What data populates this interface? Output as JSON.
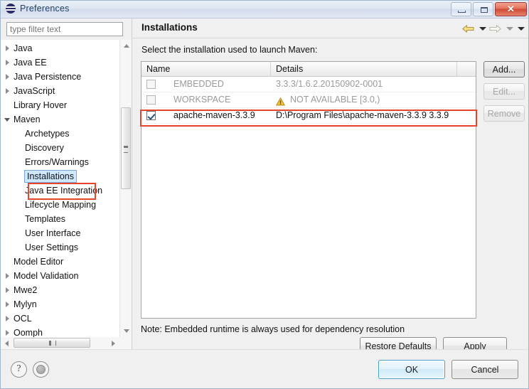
{
  "window": {
    "title": "Preferences",
    "app_icon": "eclipse-icon",
    "controls": {
      "minimize": "minimize-icon",
      "maximize": "maximize-icon",
      "close": "✕"
    }
  },
  "filter": {
    "placeholder": "type filter text",
    "value": ""
  },
  "tree": {
    "items": [
      {
        "label": "Java",
        "level": 1,
        "twisty": "collapsed",
        "selected": false
      },
      {
        "label": "Java EE",
        "level": 1,
        "twisty": "collapsed",
        "selected": false
      },
      {
        "label": "Java Persistence",
        "level": 1,
        "twisty": "collapsed",
        "selected": false
      },
      {
        "label": "JavaScript",
        "level": 1,
        "twisty": "collapsed",
        "selected": false
      },
      {
        "label": "Library Hover",
        "level": 1,
        "twisty": "none",
        "selected": false
      },
      {
        "label": "Maven",
        "level": 1,
        "twisty": "expanded",
        "selected": false
      },
      {
        "label": "Archetypes",
        "level": 2,
        "twisty": "none",
        "selected": false
      },
      {
        "label": "Discovery",
        "level": 2,
        "twisty": "none",
        "selected": false
      },
      {
        "label": "Errors/Warnings",
        "level": 2,
        "twisty": "none",
        "selected": false
      },
      {
        "label": "Installations",
        "level": 2,
        "twisty": "none",
        "selected": true
      },
      {
        "label": "Java EE Integration",
        "level": 2,
        "twisty": "none",
        "selected": false
      },
      {
        "label": "Lifecycle Mapping",
        "level": 2,
        "twisty": "none",
        "selected": false
      },
      {
        "label": "Templates",
        "level": 2,
        "twisty": "none",
        "selected": false
      },
      {
        "label": "User Interface",
        "level": 2,
        "twisty": "none",
        "selected": false
      },
      {
        "label": "User Settings",
        "level": 2,
        "twisty": "none",
        "selected": false
      },
      {
        "label": "Model Editor",
        "level": 1,
        "twisty": "none",
        "selected": false
      },
      {
        "label": "Model Validation",
        "level": 1,
        "twisty": "collapsed",
        "selected": false
      },
      {
        "label": "Mwe2",
        "level": 1,
        "twisty": "collapsed",
        "selected": false
      },
      {
        "label": "Mylyn",
        "level": 1,
        "twisty": "collapsed",
        "selected": false
      },
      {
        "label": "OCL",
        "level": 1,
        "twisty": "collapsed",
        "selected": false
      },
      {
        "label": "Oomph",
        "level": 1,
        "twisty": "collapsed",
        "selected": false
      }
    ]
  },
  "page": {
    "title": "Installations",
    "instruction": "Select the installation used to launch Maven:",
    "note": "Note: Embedded runtime is always used for dependency resolution"
  },
  "nav": {
    "back": "back-arrow-icon",
    "back_menu": "chevron-down-icon",
    "forward": "forward-arrow-icon",
    "forward_menu": "chevron-down-icon",
    "view_menu": "chevron-down-icon"
  },
  "table": {
    "columns": [
      "Name",
      "Details",
      ""
    ],
    "rows": [
      {
        "checked": false,
        "enabled": false,
        "name": "EMBEDDED",
        "details": "3.3.3/1.6.2.20150902-0001",
        "warning": false,
        "highlighted": false
      },
      {
        "checked": false,
        "enabled": false,
        "name": "WORKSPACE",
        "details": "NOT AVAILABLE [3.0,)",
        "warning": true,
        "warning_icon": "warning-triangle-icon",
        "highlighted": false
      },
      {
        "checked": true,
        "enabled": true,
        "name": "apache-maven-3.3.9",
        "details": "D:\\Program Files\\apache-maven-3.3.9 3.3.9",
        "warning": false,
        "highlighted": true
      }
    ]
  },
  "side_buttons": [
    {
      "label": "Add...",
      "disabled": false
    },
    {
      "label": "Edit...",
      "disabled": true
    },
    {
      "label": "Remove",
      "disabled": true
    }
  ],
  "page_buttons": {
    "restore_defaults": "Restore Defaults",
    "apply": "Apply"
  },
  "footer": {
    "help_icon": "question-mark-icon",
    "info_icon": "filled-circle-icon",
    "ok": "OK",
    "cancel": "Cancel"
  },
  "colors": {
    "accent": "#4ba0c9",
    "annotation": "#e8442c",
    "selection": "#cde8ff",
    "warning": "#f0b323",
    "disabled_text": "#9a9a9a"
  }
}
